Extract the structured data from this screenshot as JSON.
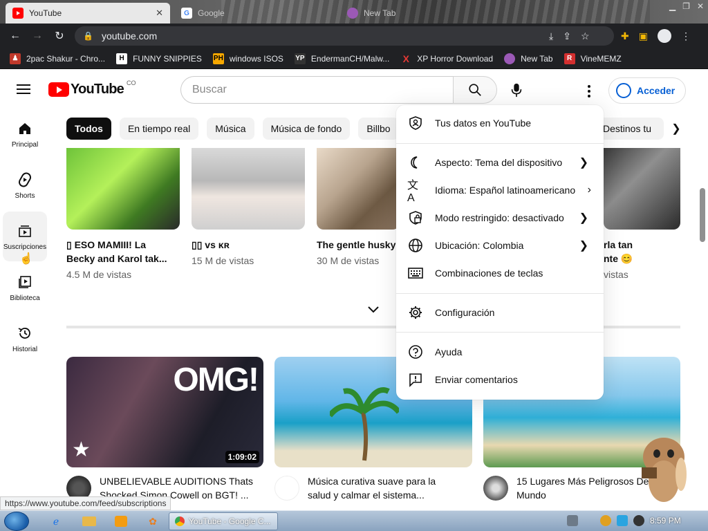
{
  "browser": {
    "tabs": [
      {
        "title": "YouTube",
        "active": true
      },
      {
        "title": "Google",
        "active": false
      },
      {
        "title": "New Tab",
        "active": false
      }
    ],
    "url": "youtube.com",
    "bookmarks": [
      {
        "label": "2pac Shakur - Chro...",
        "icon": "person-icon",
        "color": "#c0392b"
      },
      {
        "label": "FUNNY SNIPPIES",
        "icon": "h-icon",
        "color": "#ffffff"
      },
      {
        "label": "windows ISOS",
        "icon": "ph-icon",
        "color": "#f7a800"
      },
      {
        "label": "EndermanCH/Malw...",
        "icon": "yp-icon",
        "color": "#222222"
      },
      {
        "label": "XP Horror Download",
        "icon": "x-icon",
        "color": "#e53935"
      },
      {
        "label": "New Tab",
        "icon": "globe-icon",
        "color": "#9b59b6"
      },
      {
        "label": "VineMEMZ",
        "icon": "r-icon",
        "color": "#d32f2f"
      }
    ]
  },
  "header": {
    "logo_text": "YouTube",
    "country_code": "CO",
    "search_placeholder": "Buscar",
    "signin_label": "Acceder"
  },
  "sidebar": {
    "items": [
      {
        "label": "Principal",
        "icon": "home-icon"
      },
      {
        "label": "Shorts",
        "icon": "shorts-icon"
      },
      {
        "label": "Suscripciones",
        "icon": "subscriptions-icon"
      },
      {
        "label": "Biblioteca",
        "icon": "library-icon"
      },
      {
        "label": "Historial",
        "icon": "history-icon"
      }
    ]
  },
  "chips": [
    "Todos",
    "En tiempo real",
    "Música",
    "Música de fondo",
    "Billbo",
    "Destinos tu"
  ],
  "shorts": [
    {
      "title_line1": "▯ ESO MAMIII! La",
      "title_line2": "Becky and Karol tak...",
      "views": "4.5 M de vistas"
    },
    {
      "title_line1": "▯▯ vs ᴋʀ",
      "title_line2": "",
      "views": "15 M de vistas"
    },
    {
      "title_line1": "The gentle husky ▯",
      "title_line2": "",
      "views": "30 M de vistas"
    },
    {
      "title_line1": "rla tan",
      "title_line2": "nte 😊",
      "views": "vistas"
    }
  ],
  "videos": [
    {
      "title_line1": "UNBELIEVABLE AUDITIONS Thats",
      "title_line2": "Shocked Simon Cowell on BGT! ...",
      "duration": "1:09:02",
      "thumb_text": "OMG!"
    },
    {
      "title_line1": "Música curativa suave para la",
      "title_line2": "salud y calmar el sistema...",
      "duration": ""
    },
    {
      "title_line1": "15 Lugares Más Peligrosos Del",
      "title_line2": "Mundo",
      "duration": ""
    }
  ],
  "dropdown": {
    "items": [
      {
        "label": "Tus datos en YouTube",
        "icon": "shield-person-icon",
        "chevron": false
      },
      {
        "label": "Aspecto: Tema del dispositivo",
        "icon": "moon-icon",
        "chevron": true
      },
      {
        "label": "Idioma: Español latinoamericano",
        "icon": "translate-icon",
        "chevron": true
      },
      {
        "label": "Modo restringido: desactivado",
        "icon": "restricted-icon",
        "chevron": true
      },
      {
        "label": "Ubicación: Colombia",
        "icon": "globe-icon",
        "chevron": true
      },
      {
        "label": "Combinaciones de teclas",
        "icon": "keyboard-icon",
        "chevron": false
      },
      {
        "label": "Configuración",
        "icon": "gear-icon",
        "chevron": false
      },
      {
        "label": "Ayuda",
        "icon": "help-icon",
        "chevron": false
      },
      {
        "label": "Enviar comentarios",
        "icon": "feedback-icon",
        "chevron": false
      }
    ]
  },
  "status_url": "https://www.youtube.com/feed/subscriptions",
  "taskbar": {
    "chrome_label": "YouTube - Google C...",
    "clock": "8:59 PM"
  },
  "colors": {
    "yt_red": "#ff0000",
    "signin_blue": "#065fd4"
  }
}
